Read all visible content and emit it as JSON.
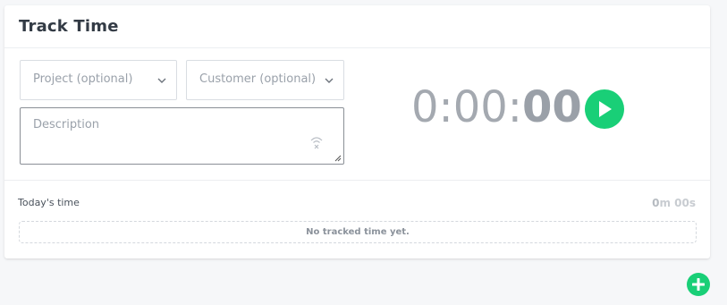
{
  "header": {
    "title": "Track Time"
  },
  "form": {
    "project_placeholder": "Project (optional)",
    "customer_placeholder": "Customer (optional)",
    "description_placeholder": "Description"
  },
  "timer": {
    "hours_minutes": "0:00:",
    "seconds": "00"
  },
  "today": {
    "label": "Today's time",
    "total_minutes": "0",
    "total_rest": "m 00s",
    "empty_message": "No tracked time yet."
  },
  "icons": {
    "project_chevron": "chevron-down-icon",
    "customer_chevron": "chevron-down-icon",
    "voice": "wifi-icon",
    "play": "play-icon",
    "add": "plus-icon"
  },
  "colors": {
    "accent": "#19cf77"
  }
}
